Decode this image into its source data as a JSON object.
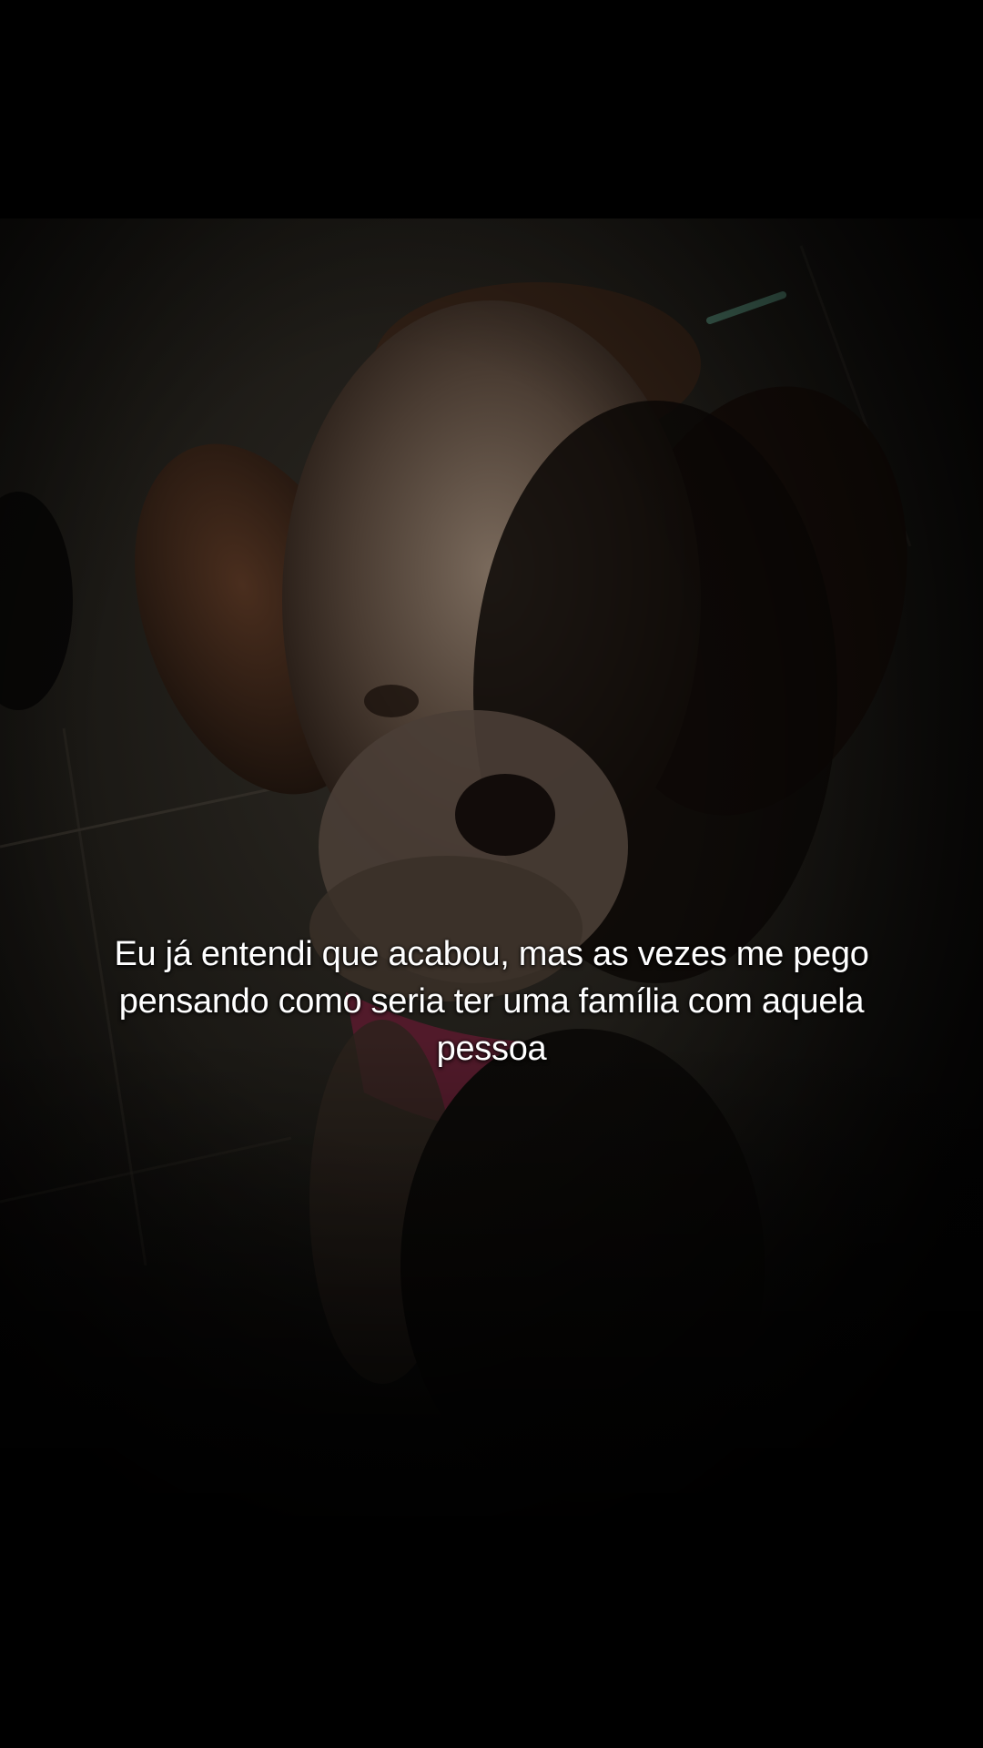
{
  "caption": {
    "text": "Eu já entendi que acabou, mas as vezes me pego pensando como seria ter uma família com aquela pessoa"
  },
  "video": {
    "subject": "dog-photo",
    "colors": {
      "background": "#000000",
      "frame_dark": "#0b0a08",
      "fur_brown": "#3a2418",
      "fur_white": "#6e5c50",
      "bandana": "#5a1a2e",
      "caption_text": "#ffffff"
    }
  }
}
